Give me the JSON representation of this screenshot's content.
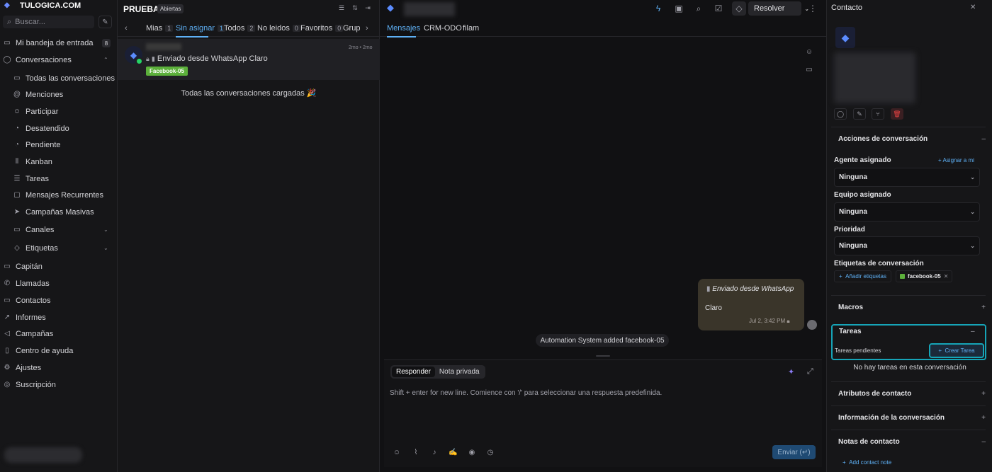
{
  "sidebar": {
    "brand": "TULOGICA.COM",
    "search_placeholder": "Buscar...",
    "inbox": {
      "label": "Mi bandeja de entrada",
      "count": "8"
    },
    "conversations_header": "Conversaciones",
    "conv_items": [
      {
        "label": "Todas las conversaciones"
      },
      {
        "label": "Menciones"
      },
      {
        "label": "Participar"
      },
      {
        "label": "Desatendido"
      },
      {
        "label": "Pendiente"
      },
      {
        "label": "Kanban"
      },
      {
        "label": "Tareas"
      },
      {
        "label": "Mensajes Recurrentes"
      },
      {
        "label": "Campañas Masivas"
      },
      {
        "label": "Canales"
      },
      {
        "label": "Etiquetas"
      }
    ],
    "main_items": [
      {
        "label": "Capitán"
      },
      {
        "label": "Llamadas"
      },
      {
        "label": "Contactos"
      },
      {
        "label": "Informes"
      },
      {
        "label": "Campañas"
      },
      {
        "label": "Centro de ayuda"
      },
      {
        "label": "Ajustes"
      },
      {
        "label": "Suscripción"
      }
    ]
  },
  "conv_list": {
    "title": "PRUEBA",
    "status": "Abiertas",
    "tabs": [
      {
        "label": "Mias",
        "count": "1"
      },
      {
        "label": "Sin asignar",
        "count": "1"
      },
      {
        "label": "Todos",
        "count": "2"
      },
      {
        "label": "No leidos",
        "count": "0"
      },
      {
        "label": "Favoritos",
        "count": "0"
      },
      {
        "label": "Grupo",
        "count": ""
      }
    ],
    "conversation": {
      "time": "2mo • 2mo",
      "message": "Enviado desde WhatsApp Claro",
      "label": "Facebook-05"
    },
    "all_loaded": "Todas las conversaciones cargadas 🎉"
  },
  "chat": {
    "resolve_label": "Resolver",
    "tabs": [
      "Mensajes",
      "CRM-ODO",
      "filam"
    ],
    "bubble": {
      "line1": "Enviado desde WhatsApp",
      "line2": "Claro",
      "time": "Jul 2, 3:42 PM"
    },
    "activity": "Automation System added facebook-05",
    "reply": {
      "mode_reply": "Responder",
      "mode_note": "Nota privada",
      "placeholder": "Shift + enter for new line. Comience con '/' para seleccionar una respuesta predefinida.",
      "send_label": "Enviar (↵)"
    }
  },
  "contact_panel": {
    "title": "Contacto",
    "acciones": "Acciones de conversación",
    "agente_label": "Agente asignado",
    "asignar_link": "Asignar a mi",
    "agente_value": "Ninguna",
    "equipo_label": "Equipo asignado",
    "equipo_value": "Ninguna",
    "prioridad_label": "Prioridad",
    "prioridad_value": "Ninguna",
    "etiquetas_label": "Etiquetas de conversación",
    "add_tags": "Añadir etiquetas",
    "tag": "facebook-05",
    "tag_color": "#5cb03b",
    "macros": "Macros",
    "tareas": "Tareas",
    "tareas_pendientes": "Tareas pendientes",
    "crear_tarea": "Crear Tarea",
    "no_tareas": "No hay tareas en esta conversación",
    "atributos": "Atributos de contacto",
    "info_conv": "Información de la conversación",
    "notas": "Notas de contacto",
    "add_note": "Add contact note"
  },
  "colors": {
    "accent": "#5eb0f5",
    "highlight": "#16a4b7",
    "label_green": "#5cb03b"
  }
}
